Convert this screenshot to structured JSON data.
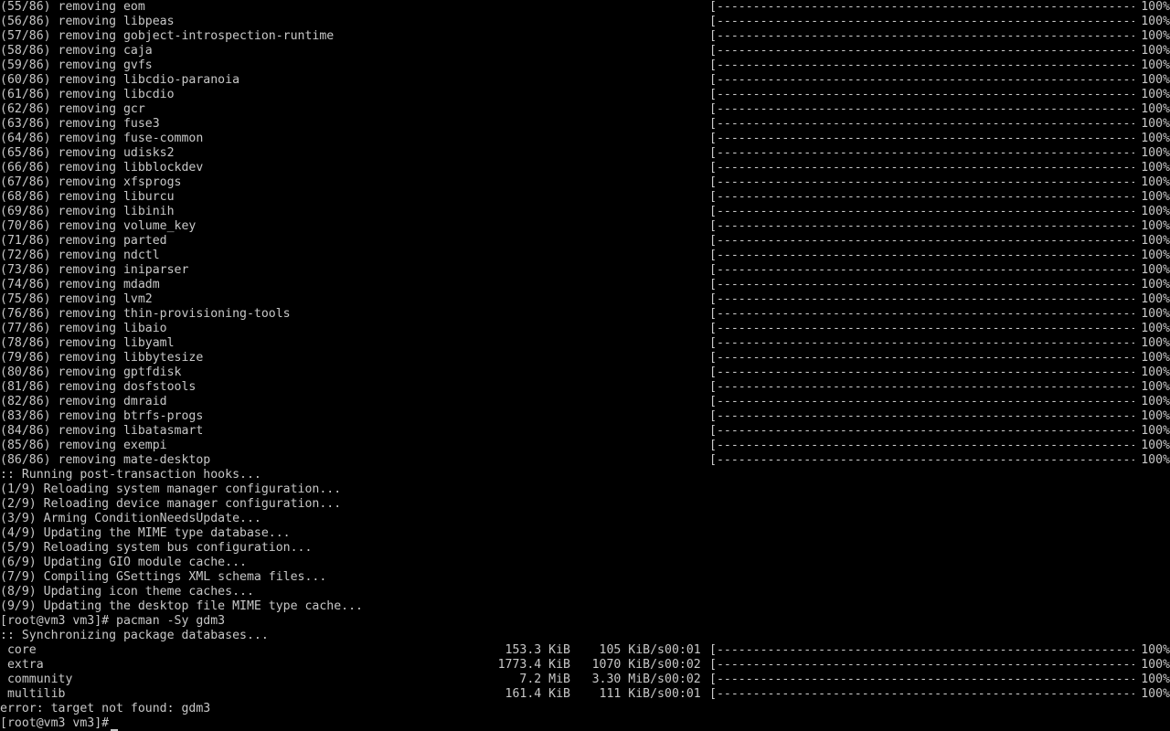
{
  "terminal": {
    "removing_lines": [
      {
        "text": "(55/86) removing eom",
        "pct": "100%"
      },
      {
        "text": "(56/86) removing libpeas",
        "pct": "100%"
      },
      {
        "text": "(57/86) removing gobject-introspection-runtime",
        "pct": "100%"
      },
      {
        "text": "(58/86) removing caja",
        "pct": "100%"
      },
      {
        "text": "(59/86) removing gvfs",
        "pct": "100%"
      },
      {
        "text": "(60/86) removing libcdio-paranoia",
        "pct": "100%"
      },
      {
        "text": "(61/86) removing libcdio",
        "pct": "100%"
      },
      {
        "text": "(62/86) removing gcr",
        "pct": "100%"
      },
      {
        "text": "(63/86) removing fuse3",
        "pct": "100%"
      },
      {
        "text": "(64/86) removing fuse-common",
        "pct": "100%"
      },
      {
        "text": "(65/86) removing udisks2",
        "pct": "100%"
      },
      {
        "text": "(66/86) removing libblockdev",
        "pct": "100%"
      },
      {
        "text": "(67/86) removing xfsprogs",
        "pct": "100%"
      },
      {
        "text": "(68/86) removing liburcu",
        "pct": "100%"
      },
      {
        "text": "(69/86) removing libinih",
        "pct": "100%"
      },
      {
        "text": "(70/86) removing volume_key",
        "pct": "100%"
      },
      {
        "text": "(71/86) removing parted",
        "pct": "100%"
      },
      {
        "text": "(72/86) removing ndctl",
        "pct": "100%"
      },
      {
        "text": "(73/86) removing iniparser",
        "pct": "100%"
      },
      {
        "text": "(74/86) removing mdadm",
        "pct": "100%"
      },
      {
        "text": "(75/86) removing lvm2",
        "pct": "100%"
      },
      {
        "text": "(76/86) removing thin-provisioning-tools",
        "pct": "100%"
      },
      {
        "text": "(77/86) removing libaio",
        "pct": "100%"
      },
      {
        "text": "(78/86) removing libyaml",
        "pct": "100%"
      },
      {
        "text": "(79/86) removing libbytesize",
        "pct": "100%"
      },
      {
        "text": "(80/86) removing gptfdisk",
        "pct": "100%"
      },
      {
        "text": "(81/86) removing dosfstools",
        "pct": "100%"
      },
      {
        "text": "(82/86) removing dmraid",
        "pct": "100%"
      },
      {
        "text": "(83/86) removing btrfs-progs",
        "pct": "100%"
      },
      {
        "text": "(84/86) removing libatasmart",
        "pct": "100%"
      },
      {
        "text": "(85/86) removing exempi",
        "pct": "100%"
      },
      {
        "text": "(86/86) removing mate-desktop",
        "pct": "100%"
      }
    ],
    "hook_lines": [
      ":: Running post-transaction hooks...",
      "(1/9) Reloading system manager configuration...",
      "(2/9) Reloading device manager configuration...",
      "(3/9) Arming ConditionNeedsUpdate...",
      "(4/9) Updating the MIME type database...",
      "(5/9) Reloading system bus configuration...",
      "(6/9) Updating GIO module cache...",
      "(7/9) Compiling GSettings XML schema files...",
      "(8/9) Updating icon theme caches...",
      "(9/9) Updating the desktop file MIME type cache..."
    ],
    "command_line": "[root@vm3 vm3]# pacman -Sy gdm3",
    "sync_header": ":: Synchronizing package databases...",
    "sync_lines": [
      {
        "name": " core",
        "size": "153.3 KiB",
        "speed": "105 KiB/s",
        "eta": "00:01",
        "pct": "100%"
      },
      {
        "name": " extra",
        "size": "1773.4 KiB",
        "speed": "1070 KiB/s",
        "eta": "00:02",
        "pct": "100%"
      },
      {
        "name": " community",
        "size": "7.2 MiB",
        "speed": "3.30 MiB/s",
        "eta": "00:02",
        "pct": "100%"
      },
      {
        "name": " multilib",
        "size": "161.4 KiB",
        "speed": "111 KiB/s",
        "eta": "00:01",
        "pct": "100%"
      }
    ],
    "error_line": "error: target not found: gdm3",
    "prompt": "[root@vm3 vm3]#",
    "progress_bar": "[-----------------------------------------------------------------------------------------------------------]",
    "progress_fraction": 1.0
  }
}
